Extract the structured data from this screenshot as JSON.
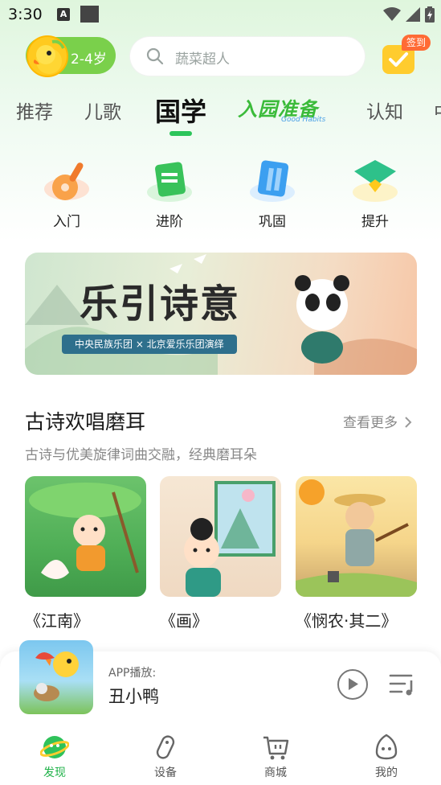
{
  "status_bar": {
    "time": "3:30",
    "a_icon_letter": "A"
  },
  "header": {
    "age_label": "2-4岁",
    "search_placeholder": "蔬菜超人",
    "signin_badge": "签到"
  },
  "tabs": [
    {
      "label": "推荐",
      "active": false
    },
    {
      "label": "儿歌",
      "active": false
    },
    {
      "label": "国学",
      "active": true
    },
    {
      "label": "入园准备",
      "sub": "Good Habits",
      "active": false
    },
    {
      "label": "认知",
      "active": false
    },
    {
      "label": "中",
      "active": false
    }
  ],
  "categories": [
    {
      "label": "入门",
      "icon": "pipa-icon"
    },
    {
      "label": "进阶",
      "icon": "book-icon"
    },
    {
      "label": "巩固",
      "icon": "scroll-icon"
    },
    {
      "label": "提升",
      "icon": "fan-icon"
    }
  ],
  "banner": {
    "title": "乐引诗意",
    "subtitle": "中央民族乐团 × 北京爱乐乐团演绎"
  },
  "section": {
    "title": "古诗欢唱磨耳",
    "see_more": "查看更多",
    "subtitle": "古诗与优美旋律词曲交融，经典磨耳朵",
    "poems": [
      {
        "title": "《江南》"
      },
      {
        "title": "《画》"
      },
      {
        "title": "《悯农·其二》"
      }
    ]
  },
  "player": {
    "label": "APP播放:",
    "name": "丑小鸭"
  },
  "bottom_nav": [
    {
      "label": "发现",
      "active": true
    },
    {
      "label": "设备",
      "active": false
    },
    {
      "label": "商城",
      "active": false
    },
    {
      "label": "我的",
      "active": false
    }
  ],
  "colors": {
    "accent": "#21b24a",
    "age_pill": "#7ad04b",
    "signin_badge": "#ff6b35"
  }
}
